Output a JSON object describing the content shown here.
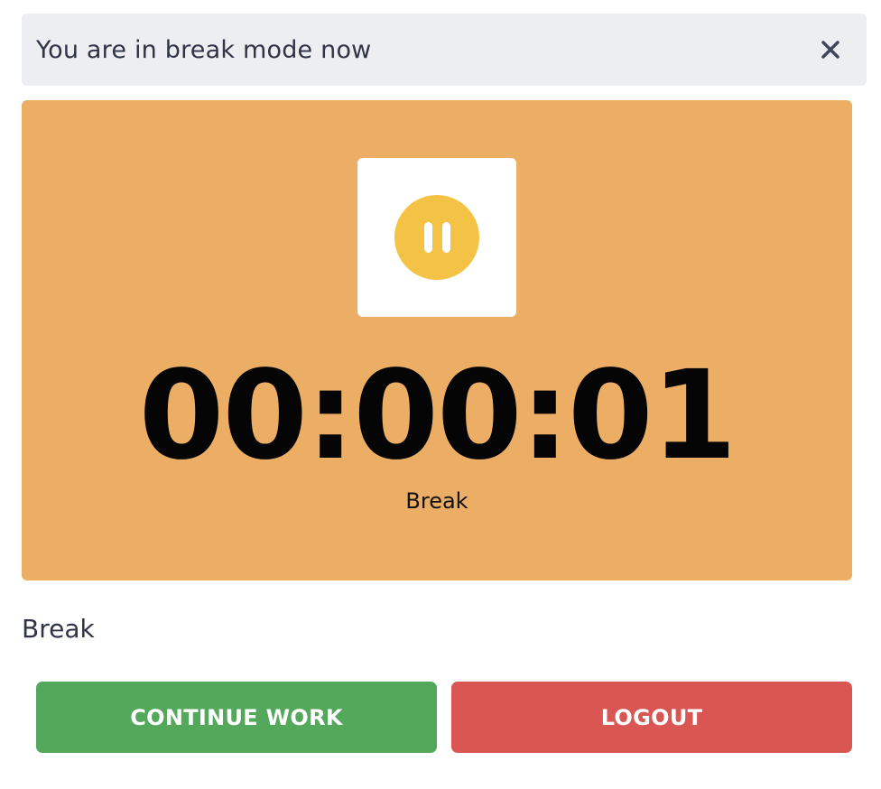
{
  "notice": {
    "message": "You are in break mode now",
    "close_icon": "close-icon"
  },
  "timer": {
    "pause_icon": "pause-icon",
    "accent_color": "#f4c245",
    "card_color": "#ebae64",
    "time": "00:00:01",
    "mode_label": "Break"
  },
  "status": {
    "label": "Break"
  },
  "actions": {
    "continue_label": "CONTINUE WORK",
    "continue_color": "#53a85b",
    "logout_label": "LOGOUT",
    "logout_color": "#d95652"
  }
}
